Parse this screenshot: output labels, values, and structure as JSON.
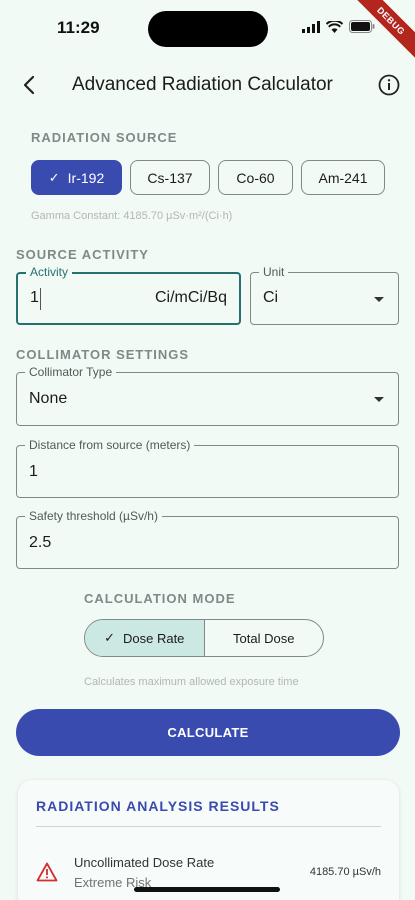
{
  "status": {
    "time": "11:29",
    "debug": "DEBUG"
  },
  "app_bar": {
    "title": "Advanced Radiation Calculator"
  },
  "radiation_source": {
    "label": "RADIATION SOURCE",
    "chips": [
      {
        "label": "Ir-192",
        "selected": true
      },
      {
        "label": "Cs-137",
        "selected": false
      },
      {
        "label": "Co-60",
        "selected": false
      },
      {
        "label": "Am-241",
        "selected": false
      }
    ],
    "gamma_constant": "Gamma Constant: 4185.70 µSv·m²/(Ci·h)"
  },
  "source_activity": {
    "label": "SOURCE ACTIVITY",
    "activity": {
      "label": "Activity",
      "value": "1",
      "suffix": "Ci/mCi/Bq"
    },
    "unit": {
      "label": "Unit",
      "value": "Ci"
    }
  },
  "collimator": {
    "label": "COLLIMATOR SETTINGS",
    "type": {
      "label": "Collimator Type",
      "value": "None"
    },
    "distance": {
      "label": "Distance from source (meters)",
      "value": "1"
    },
    "threshold": {
      "label": "Safety threshold (µSv/h)",
      "value": "2.5"
    }
  },
  "calculation_mode": {
    "label": "CALCULATION MODE",
    "options": [
      "Dose Rate",
      "Total Dose"
    ],
    "hint": "Calculates maximum allowed exposure time"
  },
  "calculate_button": "CALCULATE",
  "results": {
    "title": "RADIATION ANALYSIS RESULTS",
    "item": {
      "name": "Uncollimated Dose Rate",
      "risk": "Extreme Risk",
      "value": "4185.70 µSv/h"
    }
  },
  "colors": {
    "primary": "#3a4bb0",
    "background": "#f2faf6",
    "focus": "#28706d",
    "warning": "#d32f2f"
  }
}
